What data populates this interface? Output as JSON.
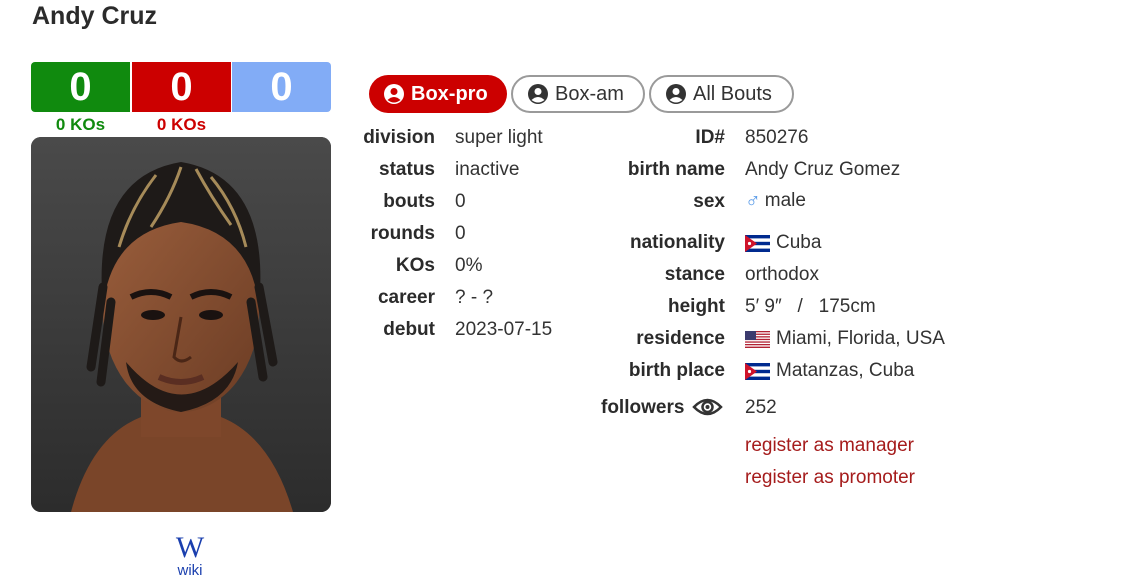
{
  "boxer": {
    "name": "Andy Cruz"
  },
  "record": {
    "wins": "0",
    "losses": "0",
    "draws": "0",
    "win_kos": "0 KOs",
    "loss_kos": "0 KOs"
  },
  "colors": {
    "win": "#108a0e",
    "loss": "#cc0000",
    "draw": "#82acf6",
    "link": "#a51c1c"
  },
  "tabs": [
    {
      "label": "Box-pro",
      "active": true,
      "icon": "user-circle-icon"
    },
    {
      "label": "Box-am",
      "active": false,
      "icon": "user-circle-icon"
    },
    {
      "label": "All Bouts",
      "active": false,
      "icon": "user-circle-icon"
    }
  ],
  "stats": {
    "division": {
      "label": "division",
      "value": "super light"
    },
    "status": {
      "label": "status",
      "value": "inactive"
    },
    "bouts": {
      "label": "bouts",
      "value": "0"
    },
    "rounds": {
      "label": "rounds",
      "value": "0"
    },
    "kos": {
      "label": "KOs",
      "value": "0%"
    },
    "career": {
      "label": "career",
      "value": "? - ?"
    },
    "debut": {
      "label": "debut",
      "value": "2023-07-15"
    }
  },
  "details": {
    "id": {
      "label": "ID#",
      "value": "850276"
    },
    "birth_name": {
      "label": "birth name",
      "value": "Andy Cruz Gomez"
    },
    "sex": {
      "label": "sex",
      "value": "male",
      "icon": "male-symbol-icon"
    },
    "nationality": {
      "label": "nationality",
      "value": "Cuba",
      "flag": "cuba-flag"
    },
    "stance": {
      "label": "stance",
      "value": "orthodox"
    },
    "height": {
      "label": "height",
      "value": "5′ 9″   /   175cm"
    },
    "residence": {
      "label": "residence",
      "value": "Miami, Florida, USA",
      "flag": "usa-flag"
    },
    "birth_place": {
      "label": "birth place",
      "value": "Matanzas, Cuba",
      "flag": "cuba-flag"
    },
    "followers": {
      "label": "followers",
      "value": "252",
      "icon": "eye-icon"
    }
  },
  "links": {
    "manager": "register as manager",
    "promoter": "register as promoter"
  },
  "wiki": {
    "glyph": "W",
    "label": "wiki"
  }
}
